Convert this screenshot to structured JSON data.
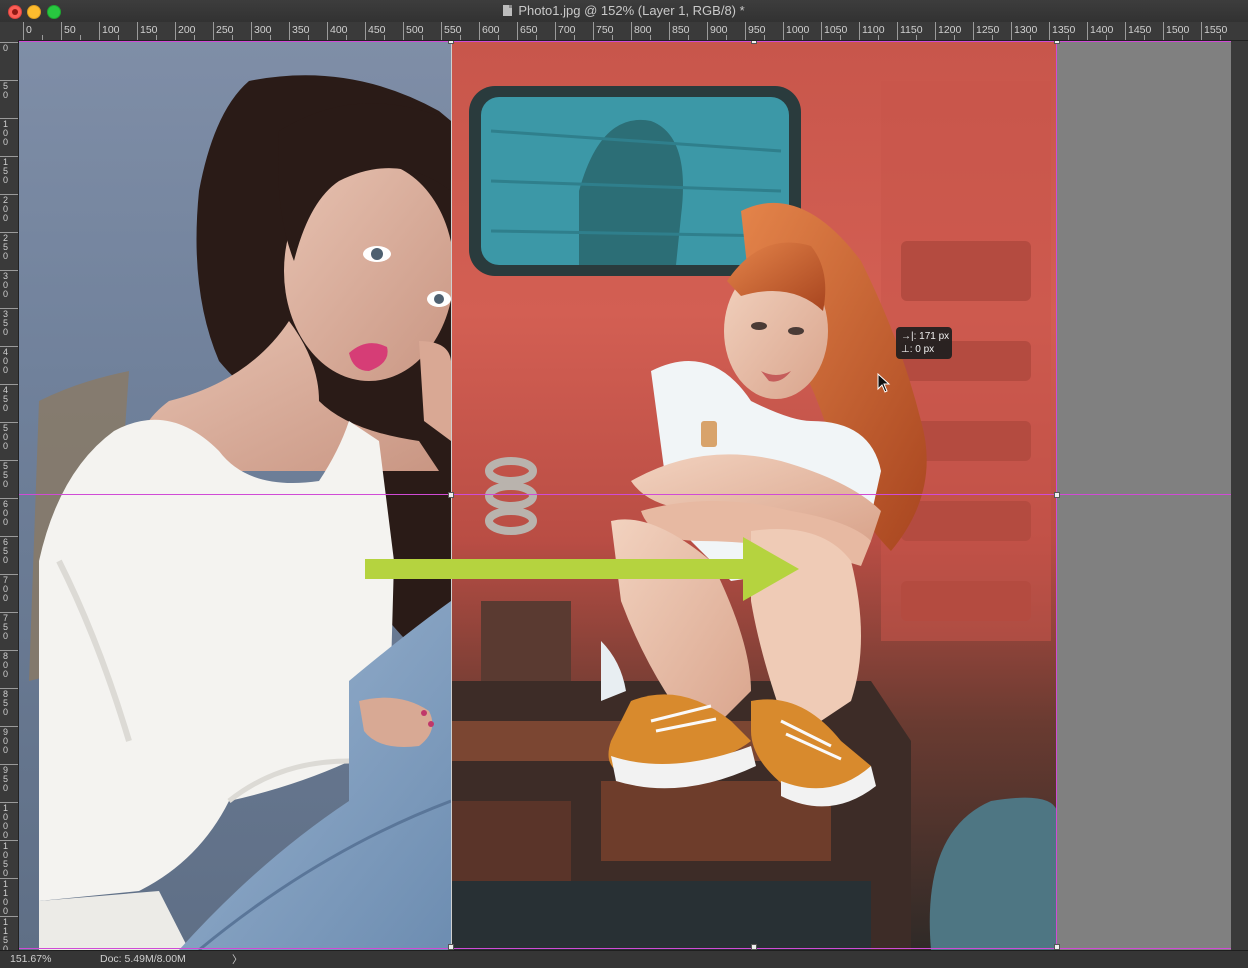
{
  "window": {
    "title": "Photo1.jpg @ 152% (Layer 1, RGB/8) *"
  },
  "ruler_top": {
    "labels": [
      "0",
      "50",
      "100",
      "150",
      "200",
      "250",
      "300",
      "350",
      "400",
      "450",
      "500",
      "550",
      "600",
      "650",
      "700",
      "750",
      "800",
      "850",
      "900",
      "950",
      "1000",
      "1050",
      "1100",
      "1150",
      "1200",
      "1250",
      "1300",
      "1350",
      "1400",
      "1450",
      "1500",
      "1550"
    ]
  },
  "ruler_left": {
    "labels": [
      "0",
      "50",
      "100",
      "150",
      "200",
      "250",
      "300",
      "350",
      "400",
      "450",
      "500",
      "550",
      "600",
      "650",
      "700",
      "750",
      "800",
      "850",
      "900",
      "950",
      "1000",
      "1050",
      "1100",
      "1150"
    ]
  },
  "tooltip": {
    "horizontal_label": "→|: 171 px",
    "vertical_label": "⊥:   0 px"
  },
  "status": {
    "zoom": "151.67%",
    "doc": "Doc: 5.49M/8.00M",
    "arrow": "〉"
  },
  "colors": {
    "guide": "#d04bd6",
    "arrow": "#b5d33f",
    "pasteboard": "#808080"
  },
  "icons": {
    "document": "document-icon",
    "cursor": "arrow-cursor-icon",
    "annotation_arrow": "right-arrow-icon"
  }
}
